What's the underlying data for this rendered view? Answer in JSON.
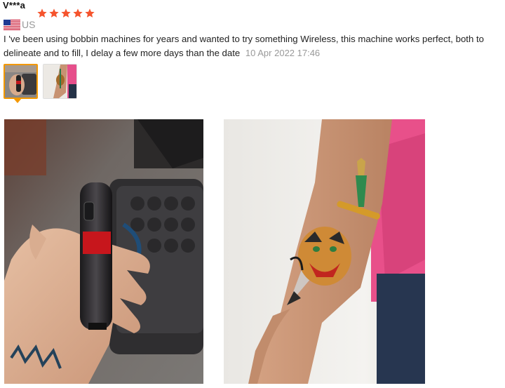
{
  "review": {
    "reviewer_name": "V***a",
    "rating": 5,
    "country_code": "US",
    "text": "I 've been using bobbin machines for years and wanted to try something Wireless, this machine works perfect, both to delineate and to fill, I delay a few more days than the date",
    "date": "10 Apr 2022 17:46"
  },
  "colors": {
    "star": "#f5542d",
    "active_thumb_border": "#f39800",
    "date_text": "#999999"
  },
  "icons": {
    "rating": "star-icon",
    "country": "us-flag-icon"
  },
  "photos": {
    "selected_index": 0,
    "count": 2
  }
}
